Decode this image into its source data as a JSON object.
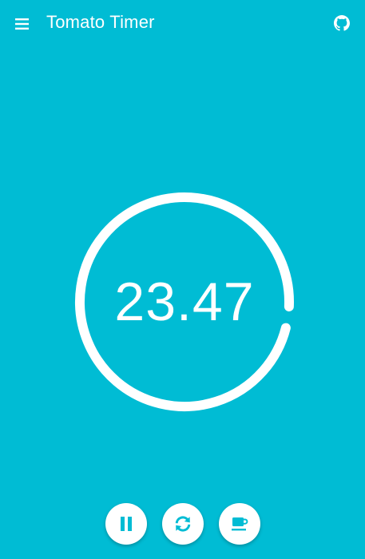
{
  "app_bar": {
    "title": "Tomato Timer",
    "menu_icon": "menu-icon",
    "github_icon": "github-icon"
  },
  "timer": {
    "display": "23.47",
    "progress": 0.98
  },
  "controls": {
    "pause_icon": "pause-icon",
    "reset_icon": "refresh-icon",
    "break_icon": "coffee-cup-icon"
  },
  "colors": {
    "background": "#00BCD4",
    "foreground": "#FFFFFF",
    "button_icon": "#00BCD4"
  }
}
